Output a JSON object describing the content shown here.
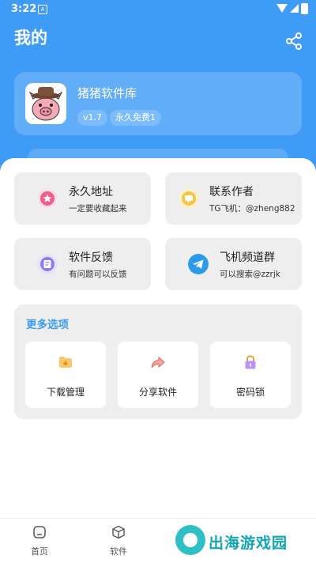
{
  "status_bar": {
    "time": "3:22",
    "app_badge": "A"
  },
  "header": {
    "title": "我的"
  },
  "profile": {
    "name": "猪猪软件库",
    "version": "v1.7",
    "tag": "永久免费1"
  },
  "tiles": [
    {
      "title": "永久地址",
      "subtitle": "一定要收藏起来",
      "icon": "star-icon",
      "color": "#f25c86"
    },
    {
      "title": "联系作者",
      "subtitle": "TG飞机：@zheng882",
      "icon": "chat-icon",
      "color": "#f5c64a"
    },
    {
      "title": "软件反馈",
      "subtitle": "有问题可以反馈",
      "icon": "feedback-icon",
      "color": "#8e7cf0"
    },
    {
      "title": "飞机频道群",
      "subtitle": "可以搜索@zzrjk",
      "icon": "telegram-icon",
      "color": "#2b9ae8"
    }
  ],
  "more": {
    "title": "更多选项",
    "items": [
      {
        "label": "下载管理",
        "icon": "download-folder-icon",
        "color": "#f5a623"
      },
      {
        "label": "分享软件",
        "icon": "share-arrow-icon",
        "color": "#f0766b"
      },
      {
        "label": "密码锁",
        "icon": "lock-icon",
        "color": "#9b6cf0"
      }
    ]
  },
  "nav": {
    "items": [
      {
        "label": "首页",
        "icon": "home-icon"
      },
      {
        "label": "软件",
        "icon": "cube-icon"
      }
    ]
  },
  "watermark": {
    "text": "出海游戏园"
  },
  "colors": {
    "primary": "#3e9bf6",
    "tile_bg": "#eeeeee"
  }
}
